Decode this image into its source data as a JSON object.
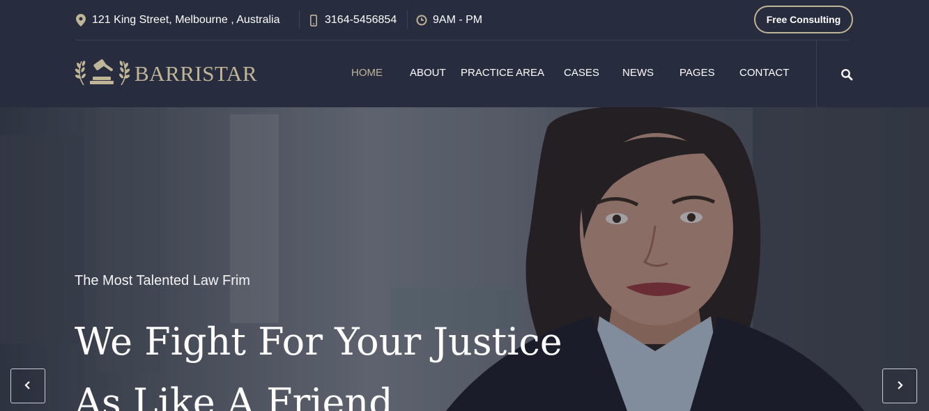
{
  "topbar": {
    "address": "121 King Street, Melbourne , Australia",
    "phone": "3164-5456854",
    "hours": "9AM - PM",
    "consult_label": "Free Consulting",
    "icons": {
      "address": "map-pin-icon",
      "phone": "mobile-phone-icon",
      "hours": "clock-icon"
    }
  },
  "brand": {
    "name": "BARRISTAR",
    "logo_icon": "gavel-laurel-icon"
  },
  "nav": {
    "items": [
      {
        "label": "HOME",
        "active": true
      },
      {
        "label": "ABOUT",
        "active": false
      },
      {
        "label": "PRACTICE AREA",
        "active": false
      },
      {
        "label": "CASES",
        "active": false
      },
      {
        "label": "NEWS",
        "active": false
      },
      {
        "label": "PAGES",
        "active": false
      },
      {
        "label": "CONTACT",
        "active": false
      }
    ],
    "search_icon": "search-icon"
  },
  "hero": {
    "subtitle": "The Most Talented Law Frim",
    "title_line1": "We Fight For Your Justice",
    "title_line2": "As Like A Friend"
  },
  "slider": {
    "prev_icon": "chevron-left-icon",
    "next_icon": "chevron-right-icon"
  },
  "colors": {
    "background": "#272c3f",
    "accent": "#c0b596",
    "text": "#ffffff"
  }
}
